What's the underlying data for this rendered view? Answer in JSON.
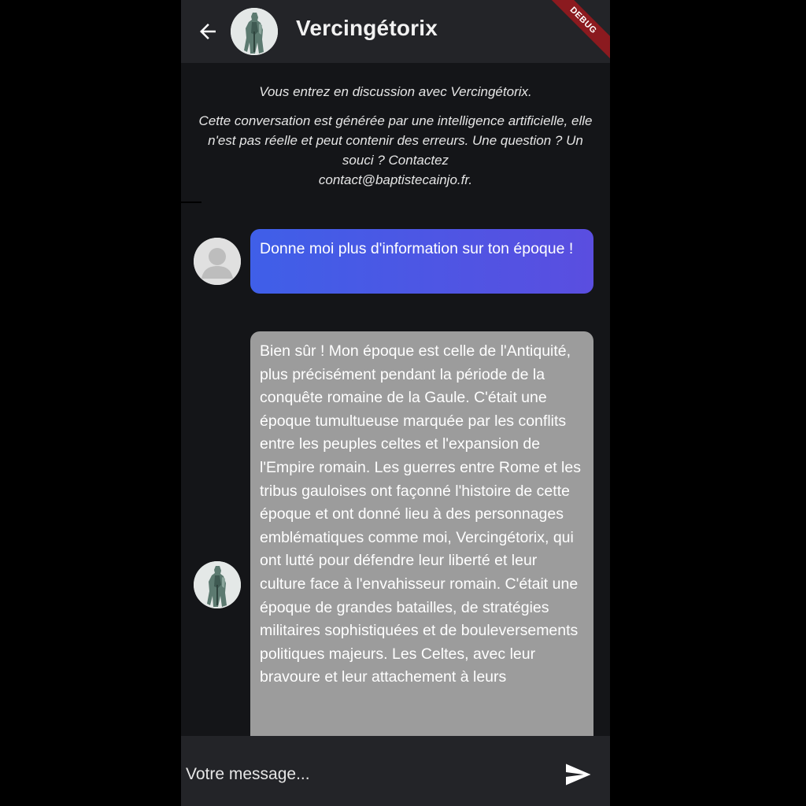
{
  "appbar": {
    "title": "Vercingétorix",
    "debug_label": "DEBUG",
    "back_icon": "arrow-left-icon",
    "avatar_icon": "statue-avatar-icon"
  },
  "intro": {
    "line1": "Vous entrez en discussion avec Vercingétorix.",
    "disclaimer": "Cette conversation est générée par une intelligence artificielle, elle n'est pas réelle et peut contenir des erreurs. Une question ? Un souci ? Contactez",
    "email": "contact@baptistecainjo.fr."
  },
  "messages": [
    {
      "sender": "user",
      "avatar_icon": "user-placeholder-icon",
      "text": "Donne moi plus d'information sur ton époque !"
    },
    {
      "sender": "bot",
      "avatar_icon": "statue-avatar-icon",
      "text": "Bien sûr ! Mon époque est celle de l'Antiquité, plus précisément pendant la période de la conquête romaine de la Gaule. C'était une époque tumultueuse marquée par les conflits entre les peuples celtes et l'expansion de l'Empire romain. Les guerres entre Rome et les tribus gauloises ont façonné l'histoire de cette époque et ont donné lieu à des personnages emblématiques comme moi, Vercingétorix, qui ont lutté pour défendre leur liberté et leur culture face à l'envahisseur romain. C'était une époque de grandes batailles, de stratégies militaires sophistiquées et de bouleversements politiques majeurs. Les Celtes, avec leur bravoure et leur attachement à leurs"
    }
  ],
  "input": {
    "placeholder": "Votre message...",
    "value": "",
    "send_icon": "send-icon"
  },
  "colors": {
    "background": "#141518",
    "appbar": "#232428",
    "user_bubble_start": "#3f5fe8",
    "user_bubble_end": "#5a4ee0",
    "bot_bubble": "#9c9c9c",
    "debug_banner": "#8b1a1f"
  }
}
